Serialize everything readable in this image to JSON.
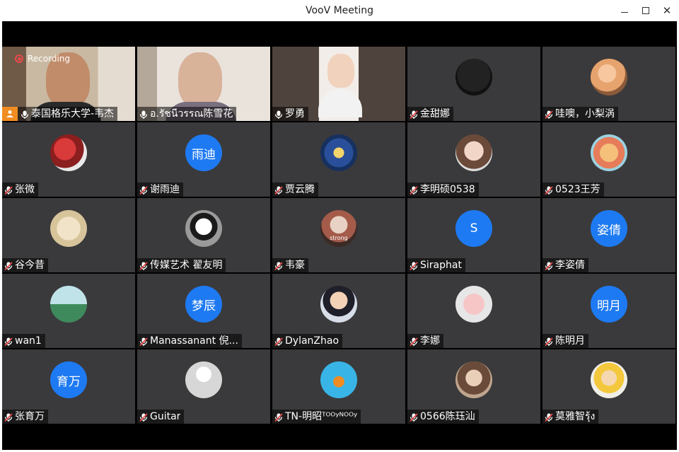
{
  "window": {
    "title": "VooV Meeting"
  },
  "recording": {
    "label": "Recording"
  },
  "colors": {
    "avatar_blue": "#1e7af2",
    "host_orange": "#f08c22",
    "active_speaker": "#36b54a",
    "muted_red": "#e84a4a"
  },
  "participants": [
    {
      "name": "泰国格乐大学-韦杰",
      "type": "video",
      "muted": false,
      "host": true
    },
    {
      "name": "อ.รัชนีวรรณ陈雪花",
      "type": "video",
      "muted": false
    },
    {
      "name": "罗勇",
      "type": "video",
      "muted": false,
      "active": true
    },
    {
      "name": "金甜娜",
      "type": "photo",
      "muted": true
    },
    {
      "name": "哇噢，小梨涡",
      "type": "photo",
      "muted": true
    },
    {
      "name": "张微",
      "type": "photo",
      "muted": true
    },
    {
      "name": "谢雨迪",
      "type": "text",
      "avatar_text": "雨迪",
      "muted": true
    },
    {
      "name": "贾云腾",
      "type": "photo",
      "muted": true
    },
    {
      "name": "李明硕0538",
      "type": "photo",
      "muted": true
    },
    {
      "name": "0523王芳",
      "type": "photo",
      "muted": true
    },
    {
      "name": "谷今昔",
      "type": "photo",
      "muted": true
    },
    {
      "name": "传媒艺术  翟友明",
      "type": "photo",
      "muted": true
    },
    {
      "name": "韦豪",
      "type": "photo",
      "muted": true,
      "photo_caption": "strong"
    },
    {
      "name": "Siraphat",
      "type": "text",
      "avatar_text": "S",
      "muted": true
    },
    {
      "name": "李姿倩",
      "type": "text",
      "avatar_text": "姿倩",
      "muted": true
    },
    {
      "name": "wan1",
      "type": "photo",
      "muted": true
    },
    {
      "name": "Manassanant 倪...",
      "type": "text",
      "avatar_text": "梦辰",
      "muted": true
    },
    {
      "name": "DylanZhao",
      "type": "photo",
      "muted": true
    },
    {
      "name": "李娜",
      "type": "photo",
      "muted": true
    },
    {
      "name": "陈明月",
      "type": "text",
      "avatar_text": "明月",
      "muted": true
    },
    {
      "name": "张育万",
      "type": "text",
      "avatar_text": "育万",
      "muted": true
    },
    {
      "name": "Guitar",
      "type": "photo",
      "muted": true
    },
    {
      "name": "TN-明昭ᵀᴼᴼʸᴺᴼᴼʸ",
      "type": "photo",
      "muted": true
    },
    {
      "name": "0566陈珏汕",
      "type": "photo",
      "muted": true
    },
    {
      "name": "莫雅智รุ้ง",
      "type": "photo",
      "muted": true
    }
  ]
}
